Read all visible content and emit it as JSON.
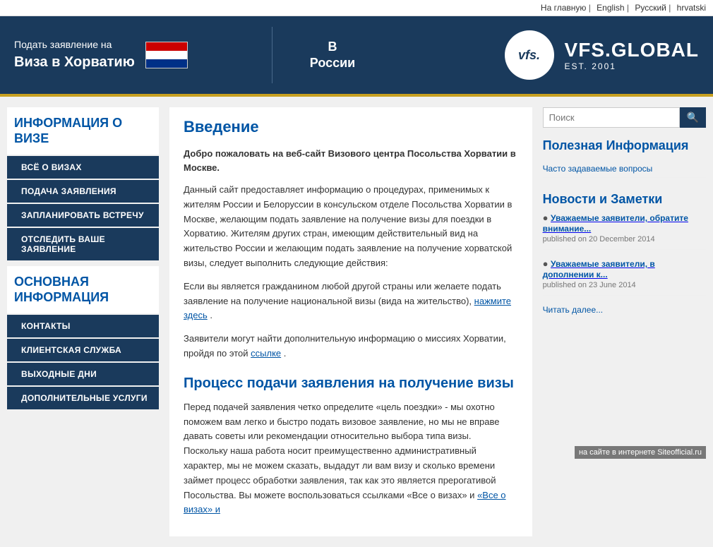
{
  "topnav": {
    "items": [
      {
        "label": "На главную",
        "href": "#"
      },
      {
        "label": "English",
        "href": "#"
      },
      {
        "label": "Русский",
        "href": "#"
      },
      {
        "label": "hrvatski",
        "href": "#"
      }
    ]
  },
  "header": {
    "line1": "Подать заявление на",
    "line2": "Виза в Хорватию",
    "middle_line1": "В",
    "middle_line2": "России",
    "vfs_logo": "vfs.",
    "vfs_name": "VFS.GLOBAL",
    "vfs_est": "EST. 2001"
  },
  "sidebar": {
    "section1_title": "ИНФОРМАЦИЯ О ВИЗЕ",
    "menu1": [
      {
        "label": "ВСЁ О ВИЗАХ"
      },
      {
        "label": "ПОДАЧА ЗАЯВЛЕНИЯ"
      },
      {
        "label": "ЗАПЛАНИРОВАТЬ ВСТРЕЧУ"
      },
      {
        "label": "ОТСЛЕДИТЬ ВАШЕ ЗАЯВЛЕНИЕ"
      }
    ],
    "section2_title": "ОСНОВНАЯ ИНФОРМАЦИЯ",
    "menu2": [
      {
        "label": "КОНТАКТЫ"
      },
      {
        "label": "КЛИЕНТСКАЯ СЛУЖБА"
      },
      {
        "label": "ВЫХОДНЫЕ ДНИ"
      },
      {
        "label": "ДОПОЛНИТЕЛЬНЫЕ УСЛУГИ"
      }
    ]
  },
  "main": {
    "title1": "Введение",
    "intro": "Добро пожаловать на веб-сайт Визового центра Посольства Хорватии в Москве.",
    "para1": "Данный сайт предоставляет информацию о процедурах, применимых к жителям России и Белоруссии в консульском отделе Посольства Хорватии в Москве, желающим подать заявление на получение визы для поездки в Хорватию. Жителям других стран, имеющим действительный вид на жительство России и желающим подать заявление на получение хорватской визы, следует выполнить следующие действия:",
    "para2_prefix": "Если вы является гражданином любой другой страны или желаете подать заявление на получение национальной визы (вида на жительство), ",
    "para2_link": "нажмите здесь",
    "para2_suffix": ".",
    "para3_prefix": "Заявители могут найти дополнительную информацию о миссиях Хорватии, пройдя по этой ",
    "para3_link": "ссылке",
    "para3_suffix": ".",
    "title2": "Процесс подачи заявления на получение визы",
    "para4": "Перед подачей заявления четко определите «цель поездки» - мы охотно поможем вам легко и быстро подать визовое заявление, но мы не вправе давать советы или рекомендации относительно выбора типа визы. Поскольку наша работа носит преимущественно административный характер, мы не можем сказать, выдадут ли вам визу и сколько времени займет процесс обработки заявления, так как это является прерогативой Посольства. Вы можете воспользоваться ссылками «Все о визах» и",
    "para4_link": "«Все о визах» и"
  },
  "right_sidebar": {
    "search_placeholder": "Поиск",
    "search_icon": "🔍",
    "section1_title": "Полезная Информация",
    "faq_link": "Часто задаваемые вопросы",
    "section2_title": "Новости и Заметки",
    "news": [
      {
        "title": "Уважаемые заявители, обратите внимание...",
        "date": "published on 20 December 2014"
      },
      {
        "title": "Уважаемые заявители, в дополнении к...",
        "date": "published on 23 June 2014"
      }
    ],
    "read_more": "Читать далее..."
  },
  "watermark": "на сайте в интернете Siteofficial.ru"
}
